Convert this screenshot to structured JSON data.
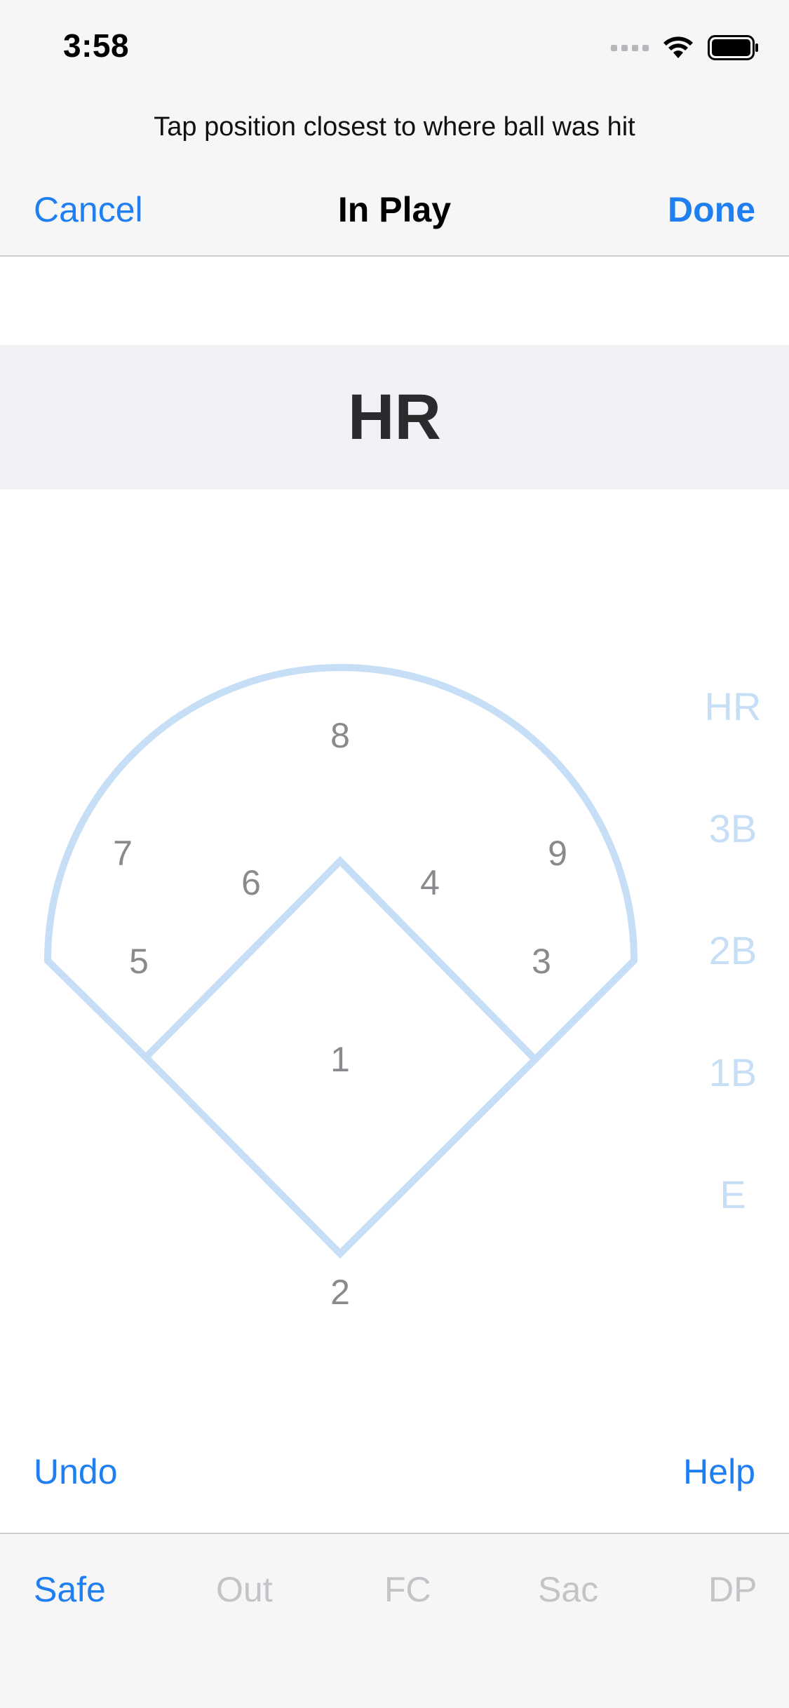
{
  "status": {
    "time": "3:58",
    "icons": [
      "cellular-signal-icon",
      "wifi-icon",
      "battery-icon"
    ]
  },
  "header": {
    "prompt": "Tap position closest to where ball was hit",
    "cancel_label": "Cancel",
    "title": "In Play",
    "done_label": "Done"
  },
  "result": {
    "label": "HR"
  },
  "field": {
    "positions": [
      {
        "id": "1",
        "label": "1"
      },
      {
        "id": "2",
        "label": "2"
      },
      {
        "id": "3",
        "label": "3"
      },
      {
        "id": "4",
        "label": "4"
      },
      {
        "id": "5",
        "label": "5"
      },
      {
        "id": "6",
        "label": "6"
      },
      {
        "id": "7",
        "label": "7"
      },
      {
        "id": "8",
        "label": "8"
      },
      {
        "id": "9",
        "label": "9"
      }
    ]
  },
  "hit_types": [
    "HR",
    "3B",
    "2B",
    "1B",
    "E"
  ],
  "actions": {
    "undo_label": "Undo",
    "help_label": "Help"
  },
  "tabs": [
    {
      "label": "Safe",
      "active": true
    },
    {
      "label": "Out",
      "active": false
    },
    {
      "label": "FC",
      "active": false
    },
    {
      "label": "Sac",
      "active": false
    },
    {
      "label": "DP",
      "active": false
    }
  ],
  "colors": {
    "accent": "#1f7ff0",
    "field_line": "#c6def6",
    "position_text": "#8a8a8e",
    "disabled": "#c4c4c8"
  }
}
